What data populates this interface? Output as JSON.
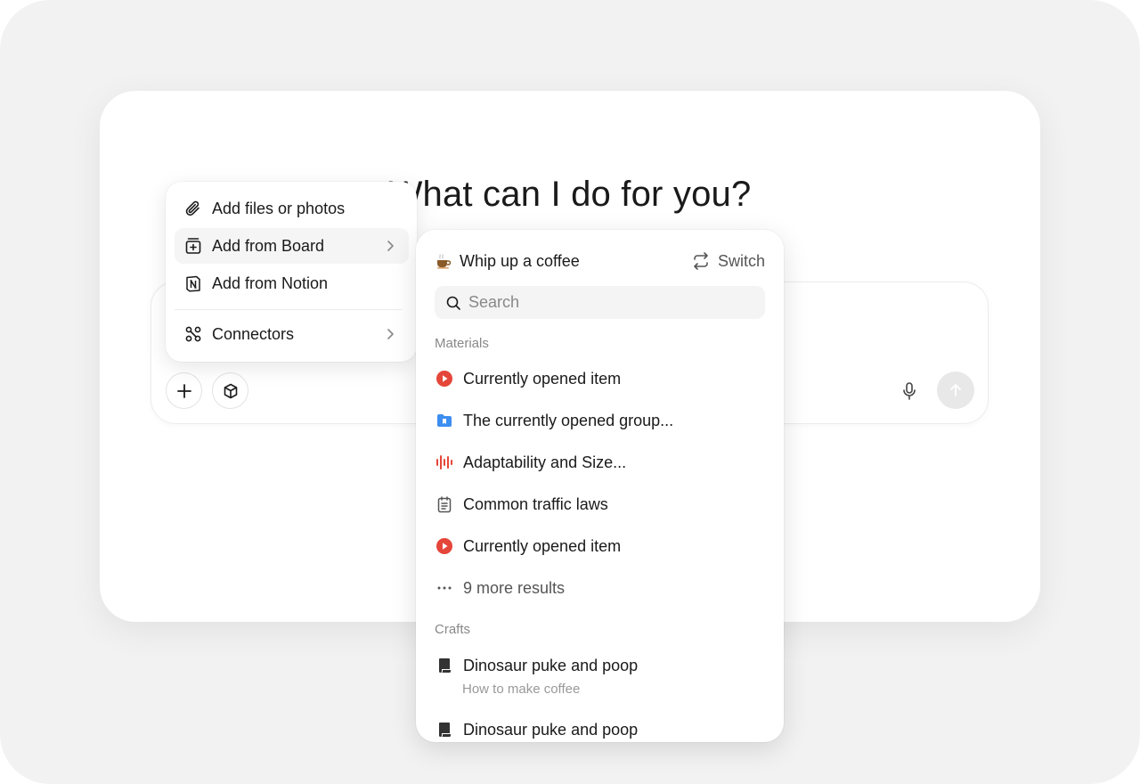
{
  "heading": "What can I do for you?",
  "composer": {
    "plus_icon": "plus-icon",
    "box_icon": "cube-icon",
    "mic_icon": "microphone-icon",
    "send_icon": "arrow-up-icon"
  },
  "add_menu": {
    "items": [
      {
        "label": "Add files or photos",
        "icon": "paperclip-icon"
      },
      {
        "label": "Add from Board",
        "icon": "board-add-icon"
      },
      {
        "label": "Add from Notion",
        "icon": "notion-icon"
      },
      {
        "label": "Connectors",
        "icon": "connectors-icon"
      }
    ]
  },
  "board_panel": {
    "title": "Whip up a coffee",
    "title_icon": "coffee-emoji",
    "switch_label": "Switch",
    "search_placeholder": "Search",
    "sections": {
      "materials": "Materials",
      "crafts": "Crafts"
    },
    "materials": [
      {
        "label": "Currently opened item",
        "icon": "video-play-icon"
      },
      {
        "label": "The currently opened group...",
        "icon": "folder-icon"
      },
      {
        "label": "Adaptability and Size...",
        "icon": "audio-wave-icon"
      },
      {
        "label": "Common traffic laws",
        "icon": "notepad-icon"
      },
      {
        "label": "Currently opened item",
        "icon": "video-play-icon"
      }
    ],
    "more_results": "9 more results",
    "crafts": [
      {
        "label": "Dinosaur puke and poop",
        "subtitle": "How to make coffee",
        "icon": "scroll-icon"
      },
      {
        "label": "Dinosaur puke and poop",
        "icon": "scroll-icon"
      }
    ]
  },
  "colors": {
    "accent_red": "#e5463a",
    "folder_blue": "#3d8ef0"
  }
}
